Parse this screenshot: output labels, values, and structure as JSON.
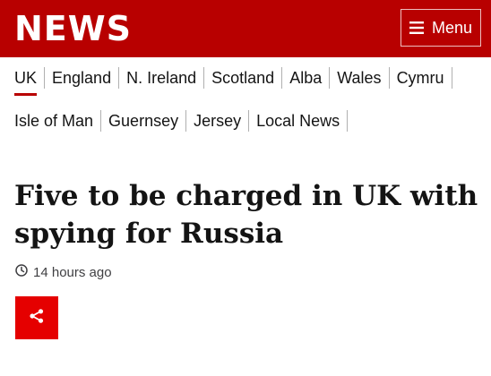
{
  "header": {
    "logo_text": "NEWS",
    "menu_label": "Menu",
    "bar_color": "#b80000"
  },
  "nav": {
    "row1": [
      "UK",
      "England",
      "N. Ireland",
      "Scotland",
      "Alba",
      "Wales",
      "Cymru"
    ],
    "row2": [
      "Isle of Man",
      "Guernsey",
      "Jersey",
      "Local News"
    ],
    "active": "UK"
  },
  "article": {
    "headline": "Five to be charged in UK with spying for Russia",
    "timestamp": "14 hours ago",
    "timestamp_icon": "clock-icon",
    "share_icon": "share-icon",
    "share_color": "#e50000"
  }
}
